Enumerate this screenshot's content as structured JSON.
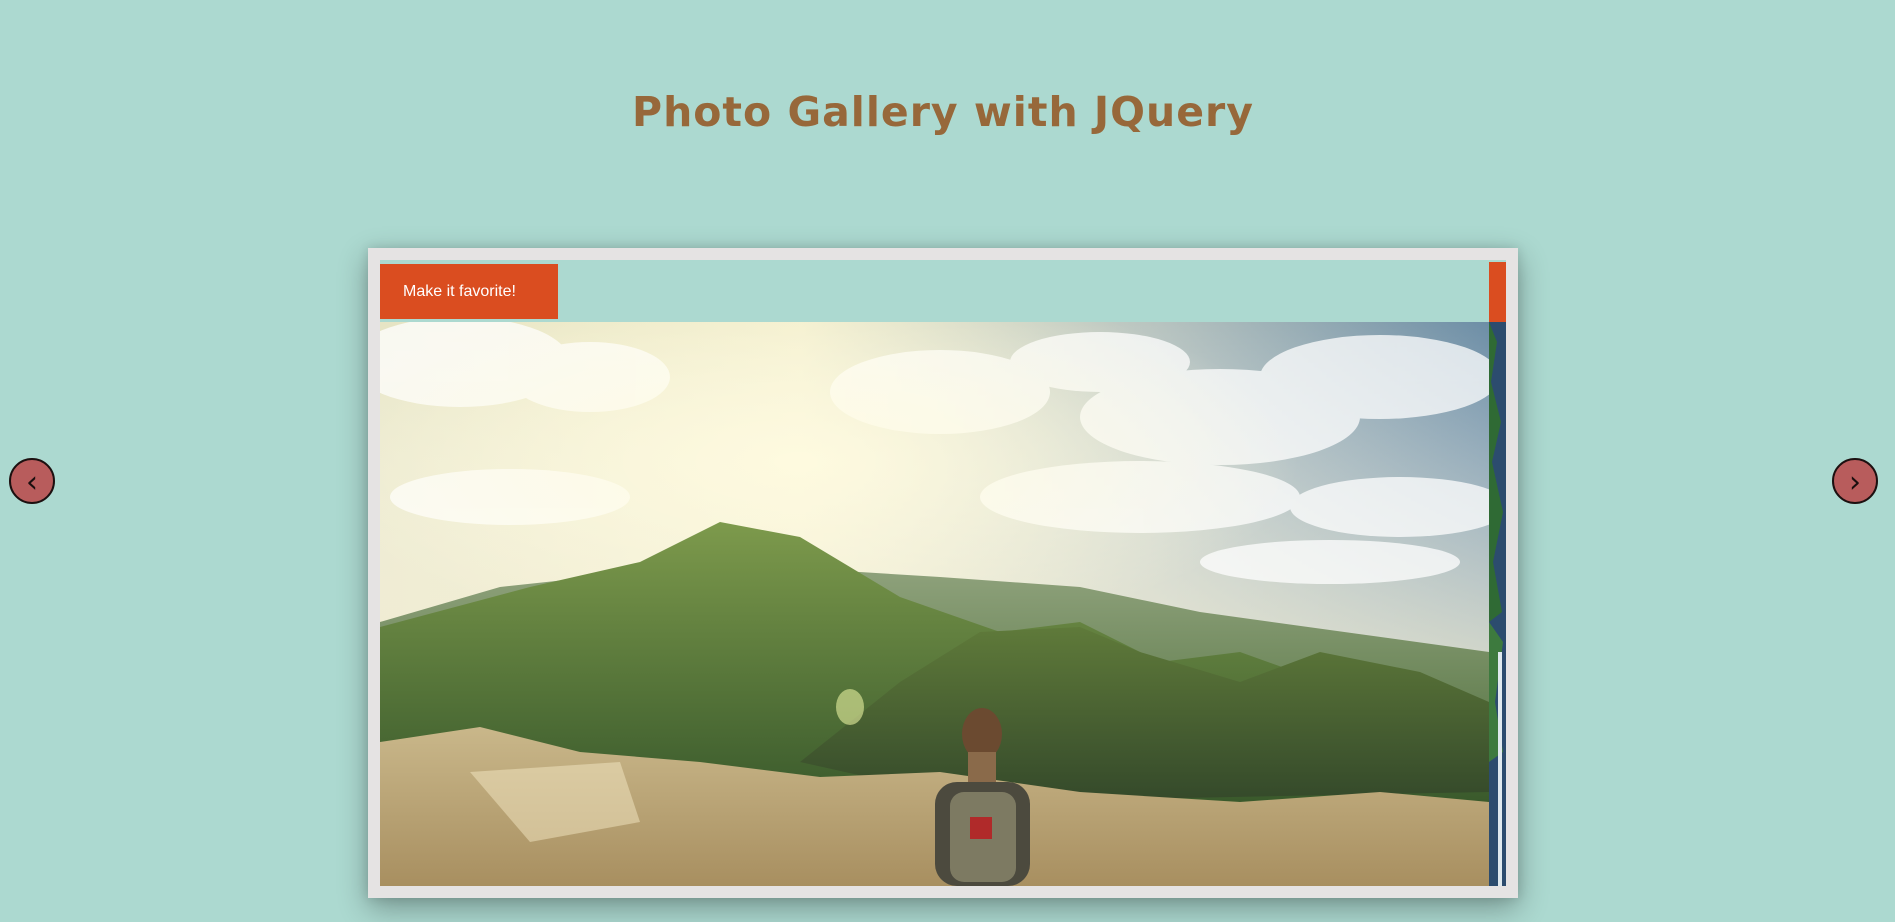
{
  "page": {
    "title": "Photo Gallery with JQuery"
  },
  "gallery": {
    "prev_label": "‹",
    "next_label": "›",
    "slides": [
      {
        "favorite_label": "Make it favorite!"
      },
      {
        "favorite_label": ""
      }
    ]
  },
  "colors": {
    "background": "#acd9d0",
    "title": "#97683a",
    "frame": "#e5e3e3",
    "favorite_button": "#da4d20",
    "nav_button": "#b85c5c"
  },
  "icons": {
    "prev": "chevron-left-icon",
    "next": "chevron-right-icon"
  }
}
